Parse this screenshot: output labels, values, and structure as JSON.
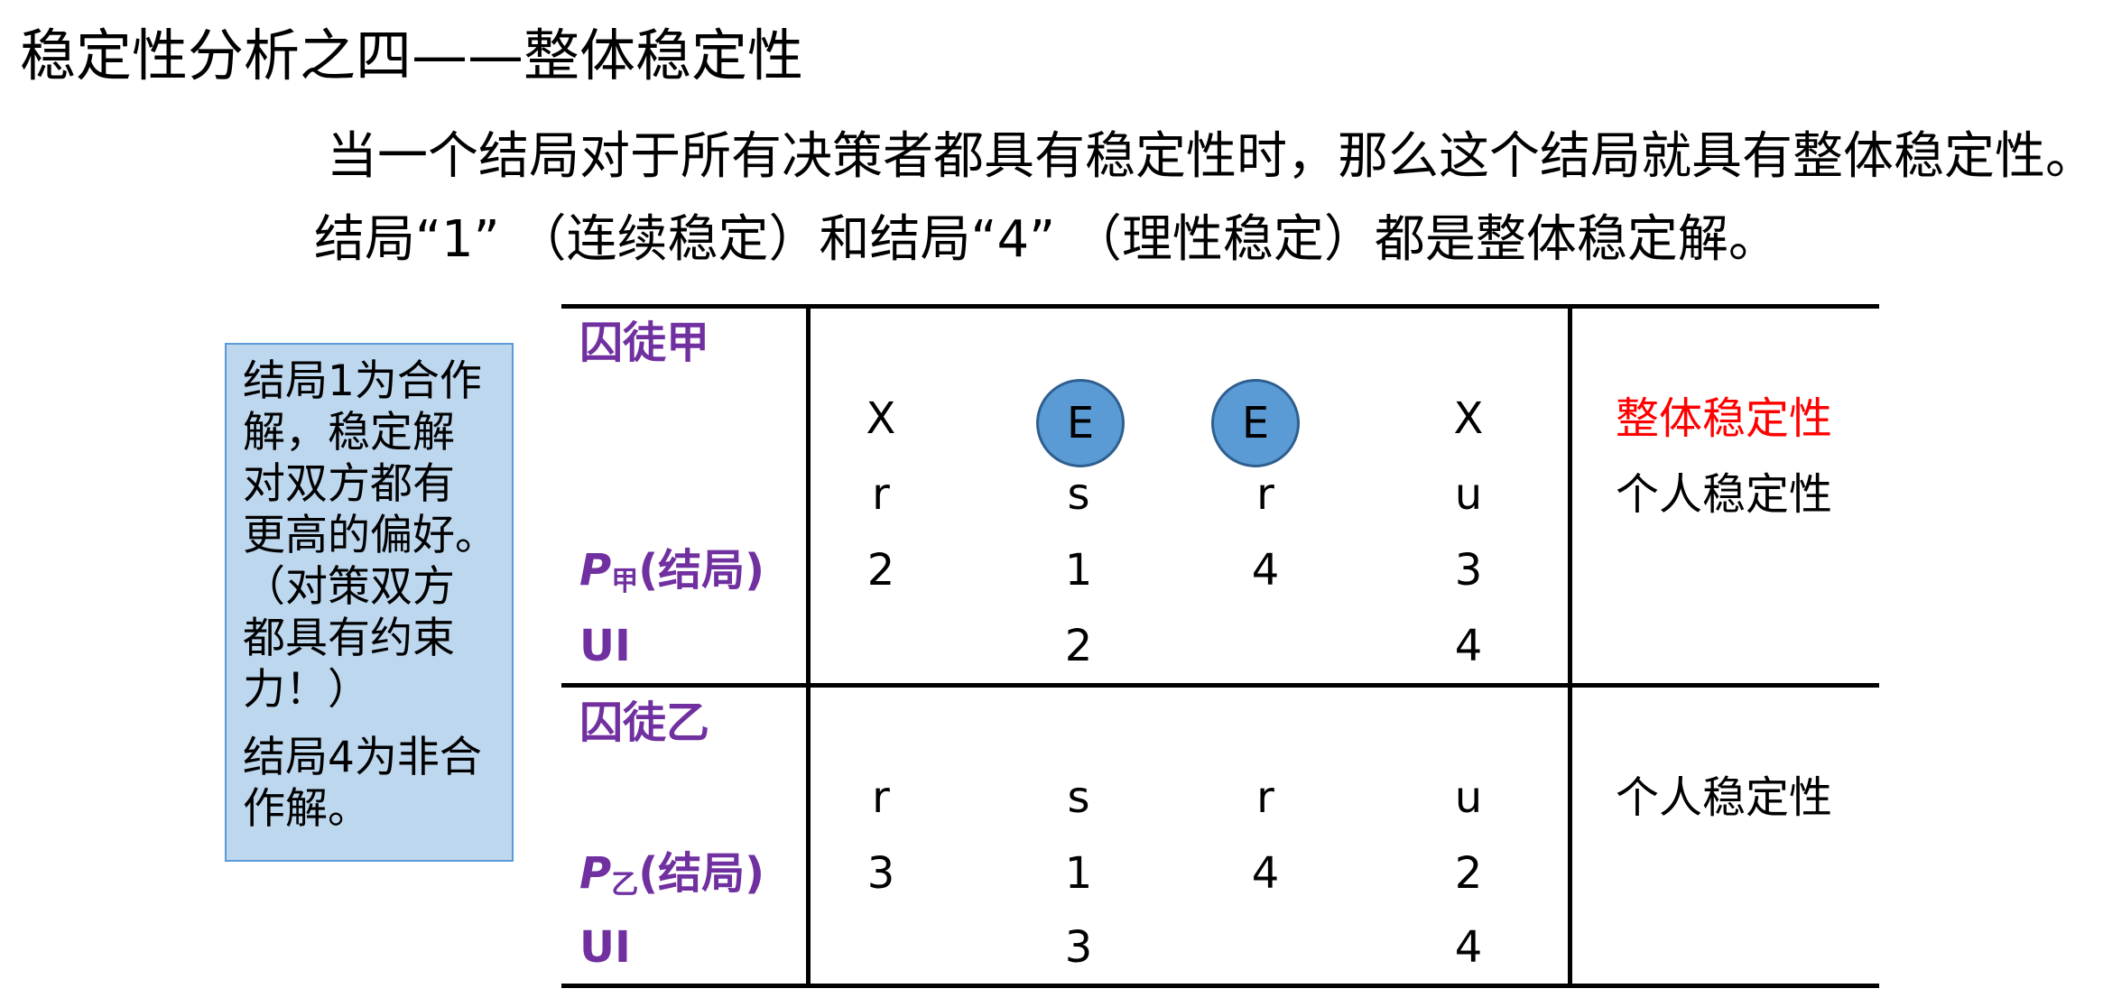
{
  "title": "稳定性分析之四——整体稳定性",
  "intro": {
    "line1": "当一个结局对于所有决策者都具有稳定性时，那么这个结局就具有整体稳定性。",
    "line2": "结局“1” （连续稳定）和结局“4” （理性稳定）都是整体稳定解。"
  },
  "note": {
    "line1": "结局1为合作",
    "line2": "解，稳定解",
    "line3": "对双方都有",
    "line4": "更高的偏好。",
    "line5": "（对策双方",
    "line6": "都具有约束",
    "line7": "力！）",
    "line8": "结局4为非合",
    "line9": "作解。"
  },
  "table": {
    "player_a": {
      "name": "囚徒甲",
      "stability_marks": [
        "X",
        "E",
        "E",
        "X"
      ],
      "stability_types": [
        "r",
        "s",
        "r",
        "u"
      ],
      "pref_label_p": "P",
      "pref_label_sub": "甲",
      "pref_label_rest": "(结局)",
      "preferences": [
        "2",
        "1",
        "4",
        "3"
      ],
      "ui_label": "UI",
      "ui_values": [
        "",
        "2",
        "",
        "4"
      ],
      "right_top": "整体稳定性",
      "right_mid": "个人稳定性"
    },
    "player_b": {
      "name": "囚徒乙",
      "stability_types": [
        "r",
        "s",
        "r",
        "u"
      ],
      "pref_label_p": "P",
      "pref_label_sub": "乙",
      "pref_label_rest": "(结局)",
      "preferences": [
        "3",
        "1",
        "4",
        "2"
      ],
      "ui_label": "UI",
      "ui_values": [
        "",
        "3",
        "",
        "4"
      ],
      "right_mid": "个人稳定性"
    }
  },
  "colors": {
    "label_purple": "#7030a0",
    "global_red": "#ff0000",
    "note_bg": "#bdd7ee",
    "circle_fill": "#5b9bd5"
  }
}
